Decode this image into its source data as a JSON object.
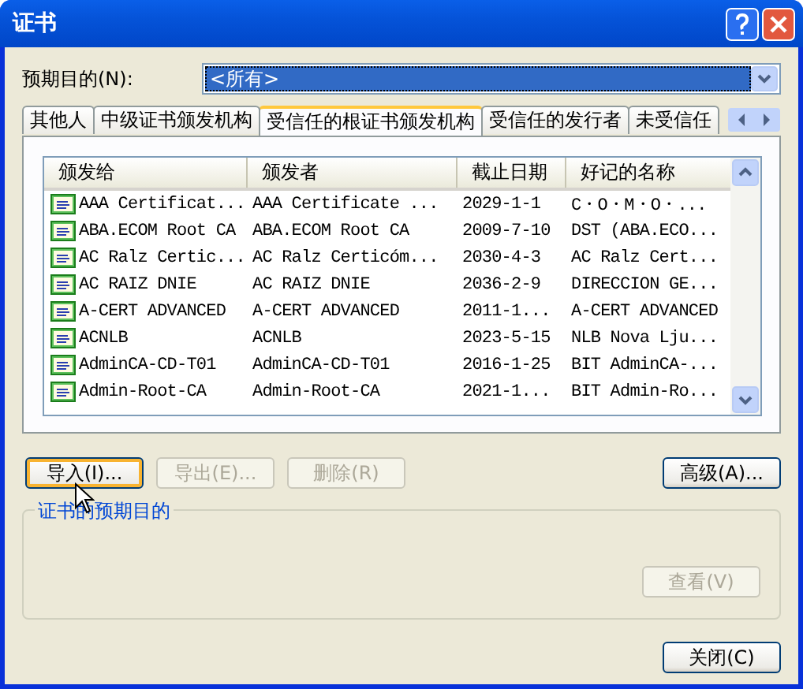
{
  "window": {
    "title": "证书"
  },
  "purpose": {
    "label": "预期目的(N):",
    "value": "<所有>"
  },
  "tabs": [
    {
      "label": "其他人",
      "selected": false
    },
    {
      "label": "中级证书颁发机构",
      "selected": false
    },
    {
      "label": "受信任的根证书颁发机构",
      "selected": true
    },
    {
      "label": "受信任的发行者",
      "selected": false
    },
    {
      "label": "未受信任",
      "selected": false
    }
  ],
  "table": {
    "columns": [
      "颁发给",
      "颁发者",
      "截止日期",
      "好记的名称"
    ],
    "rows": [
      [
        "AAA Certificat...",
        "AAA Certificate ...",
        "2029-1-1",
        "C・O・M・O・..."
      ],
      [
        "ABA.ECOM Root CA",
        "ABA.ECOM Root CA",
        "2009-7-10",
        "DST (ABA.ECO..."
      ],
      [
        "AC Ralz Certic...",
        "AC Ralz Certicóm...",
        "2030-4-3",
        "AC Ralz Cert..."
      ],
      [
        "AC RAIZ DNIE",
        "AC RAIZ DNIE",
        "2036-2-9",
        "DIRECCION GE..."
      ],
      [
        "A-CERT ADVANCED",
        "A-CERT ADVANCED",
        "2011-1...",
        "A-CERT ADVANCED"
      ],
      [
        "ACNLB",
        "ACNLB",
        "2023-5-15",
        "NLB Nova Lju..."
      ],
      [
        "AdminCA-CD-T01",
        "AdminCA-CD-T01",
        "2016-1-25",
        "BIT AdminCA-..."
      ],
      [
        "Admin-Root-CA",
        "Admin-Root-CA",
        "2021-1...",
        "BIT Admin-Ro..."
      ]
    ]
  },
  "buttons": [
    {
      "label": "导入(I)...",
      "disabled": false,
      "hot": true
    },
    {
      "label": "导出(E)...",
      "disabled": true,
      "hot": false
    },
    {
      "label": "删除(R)",
      "disabled": true,
      "hot": false
    }
  ],
  "advanced_button": {
    "label": "高级(A)...",
    "disabled": false
  },
  "purposes_group": {
    "title": "证书的预期目的",
    "view_button": {
      "label": "查看(V)",
      "disabled": true
    }
  },
  "close_button": {
    "label": "关闭(C)",
    "disabled": false
  }
}
